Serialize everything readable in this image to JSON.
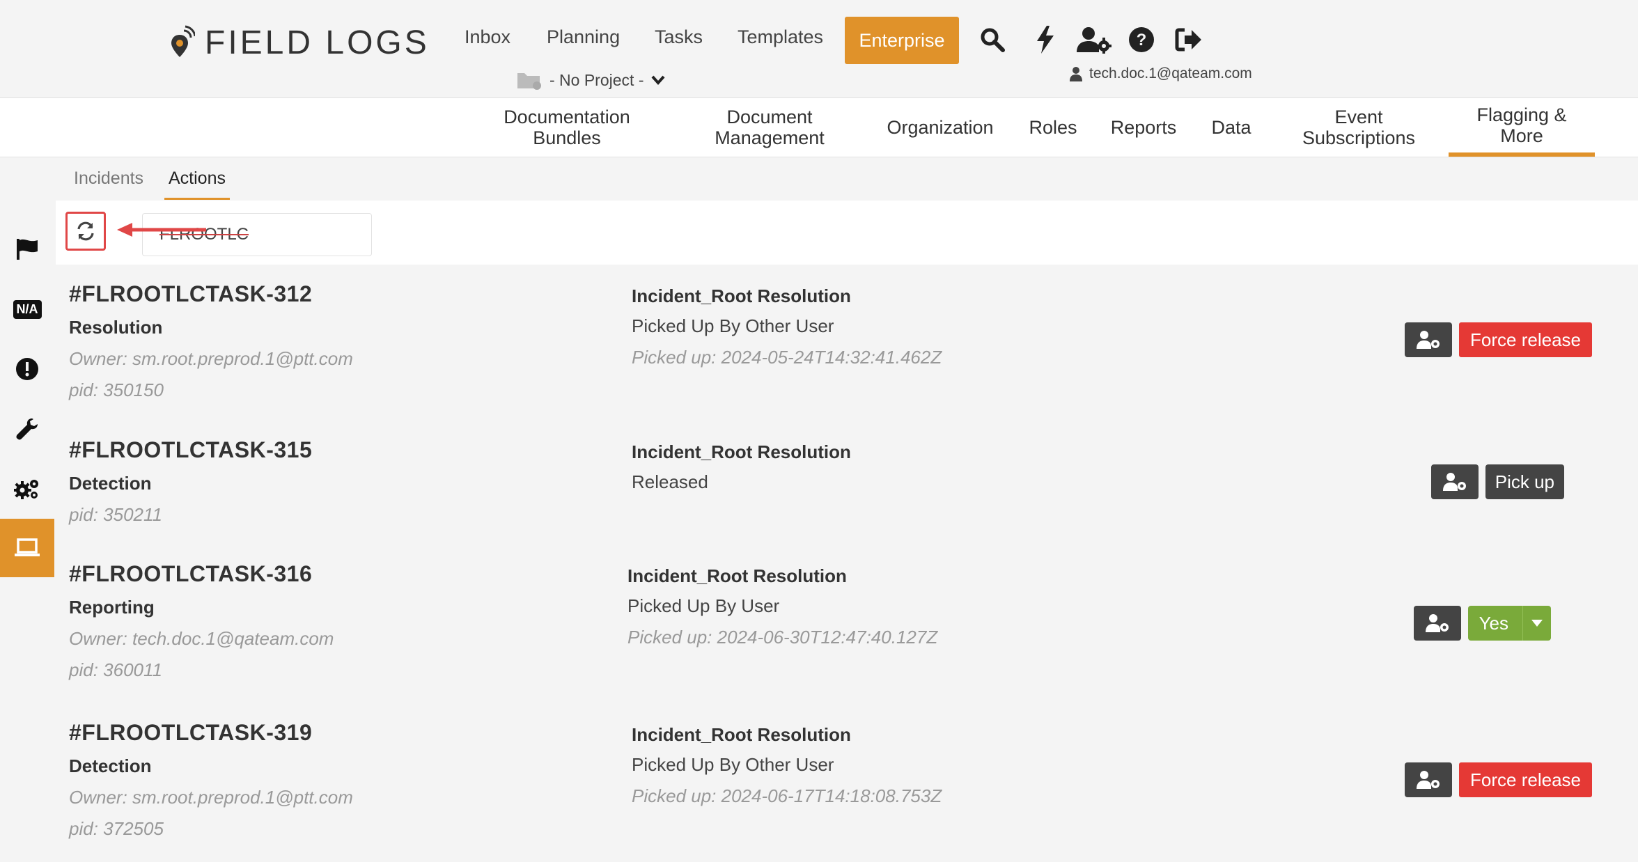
{
  "app": {
    "brand": "FIELD LOGS",
    "colors": {
      "accent": "#e0922a",
      "danger": "#e53935",
      "success": "#7aaa3a",
      "dark": "#444444"
    }
  },
  "topnav": {
    "items": [
      "Inbox",
      "Planning",
      "Tasks",
      "Templates"
    ],
    "enterprise": "Enterprise",
    "icons": [
      "search-icon",
      "bolt-icon",
      "user-settings-icon",
      "help-icon",
      "logout-icon"
    ]
  },
  "project": {
    "label": "- No Project -"
  },
  "user": {
    "email": "tech.doc.1@qateam.com"
  },
  "subnav": {
    "items": [
      {
        "line1": "Documentation",
        "line2": "Bundles"
      },
      {
        "line1": "Document",
        "line2": "Management"
      },
      {
        "line1": "Organization",
        "line2": ""
      },
      {
        "line1": "Roles",
        "line2": ""
      },
      {
        "line1": "Reports",
        "line2": ""
      },
      {
        "line1": "Data",
        "line2": ""
      },
      {
        "line1": "Event",
        "line2": "Subscriptions"
      },
      {
        "line1": "Flagging &",
        "line2": "More"
      }
    ],
    "active": "Flagging & More"
  },
  "rail": {
    "items": [
      "flag-icon",
      "na-icon",
      "alert-icon",
      "wrench-icon",
      "gears-icon",
      "laptop-icon"
    ],
    "na_label": "N/A",
    "active": "laptop-icon"
  },
  "tabs": {
    "items": [
      "Incidents",
      "Actions"
    ],
    "active": "Actions"
  },
  "search": {
    "value": "FLROOTLC"
  },
  "tasks": [
    {
      "id": "#FLROOTLCTASK-312",
      "phase": "Resolution",
      "owner": "Owner: sm.root.preprod.1@ptt.com",
      "pid": "pid: 350150",
      "type": "Incident_Root Resolution",
      "status": "Picked Up By Other User",
      "picked": "Picked up: 2024-05-24T14:32:41.462Z",
      "action": "Force release"
    },
    {
      "id": "#FLROOTLCTASK-315",
      "phase": "Detection",
      "pid": "pid: 350211",
      "type": "Incident_Root Resolution",
      "status": "Released",
      "action": "Pick up"
    },
    {
      "id": "#FLROOTLCTASK-316",
      "phase": "Reporting",
      "owner": "Owner: tech.doc.1@qateam.com",
      "pid": "pid: 360011",
      "type": "Incident_Root Resolution",
      "status": "Picked Up By User",
      "picked": "Picked up: 2024-06-30T12:47:40.127Z",
      "action": "Yes"
    },
    {
      "id": "#FLROOTLCTASK-319",
      "phase": "Detection",
      "owner": "Owner: sm.root.preprod.1@ptt.com",
      "pid": "pid: 372505",
      "type": "Incident_Root Resolution",
      "status": "Picked Up By Other User",
      "picked": "Picked up: 2024-06-17T14:18:08.753Z",
      "action": "Force release"
    }
  ]
}
